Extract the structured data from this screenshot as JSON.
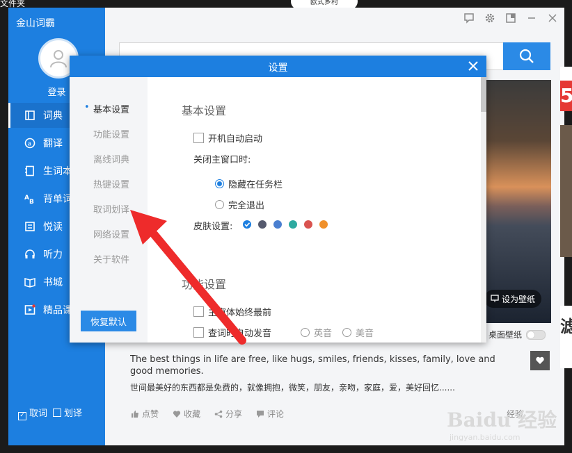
{
  "desktop": {
    "label": "文件夹",
    "bubble_text": "欧式乡村"
  },
  "app": {
    "title": "金山词霸",
    "login": "登录",
    "nav": [
      {
        "label": "词典",
        "icon": "dictionary-icon"
      },
      {
        "label": "翻译",
        "icon": "translate-icon"
      },
      {
        "label": "生词本",
        "icon": "notebook-icon"
      },
      {
        "label": "背单词",
        "icon": "vocab-icon"
      },
      {
        "label": "悦读",
        "icon": "reading-icon"
      },
      {
        "label": "听力",
        "icon": "headphone-icon"
      },
      {
        "label": "书城",
        "icon": "book-icon"
      },
      {
        "label": "精品课",
        "icon": "video-icon"
      }
    ],
    "bottom_checks": {
      "quci": "取词",
      "huayi": "划译"
    },
    "photo": {
      "wallpaper_btn": "设为壁纸",
      "desktop_wallpaper": "桌面壁纸"
    },
    "quote": {
      "en": "The best things in life are free, like hugs, smiles, friends, kisses, family, love and good memories.",
      "cn": "世间最美好的东西都是免费的，就像拥抱，微笑，朋友，亲吻，家庭，爱，美好回忆......"
    },
    "actions": {
      "like": "点赞",
      "collect": "收藏",
      "share": "分享",
      "comment": "评论"
    },
    "share_right": "经验",
    "watermark": {
      "brand": "Baidu 经验",
      "url": "jingyan.baidu.com"
    },
    "edge_text": {
      "e1": "5",
      "e2": "滤"
    }
  },
  "dialog": {
    "title": "设置",
    "menu": [
      "基本设置",
      "功能设置",
      "离线词典",
      "热键设置",
      "取词划译",
      "网络设置",
      "关于软件"
    ],
    "reset_label": "恢复默认",
    "basic": {
      "title": "基本设置",
      "autostart": "开机自动启动",
      "close_label": "关闭主窗口时:",
      "close_options": [
        "隐藏在任务栏",
        "完全退出"
      ],
      "skin_label": "皮肤设置:"
    },
    "skins": [
      "#1d7fe0",
      "#555a6e",
      "#4a7fd0",
      "#2eaaa0",
      "#d9534f",
      "#f0902a"
    ],
    "function": {
      "title": "功能设置",
      "always_top": "主窗体始终最前",
      "auto_pron": "查词时自动发音",
      "pron_options": [
        "英音",
        "美音"
      ]
    }
  }
}
